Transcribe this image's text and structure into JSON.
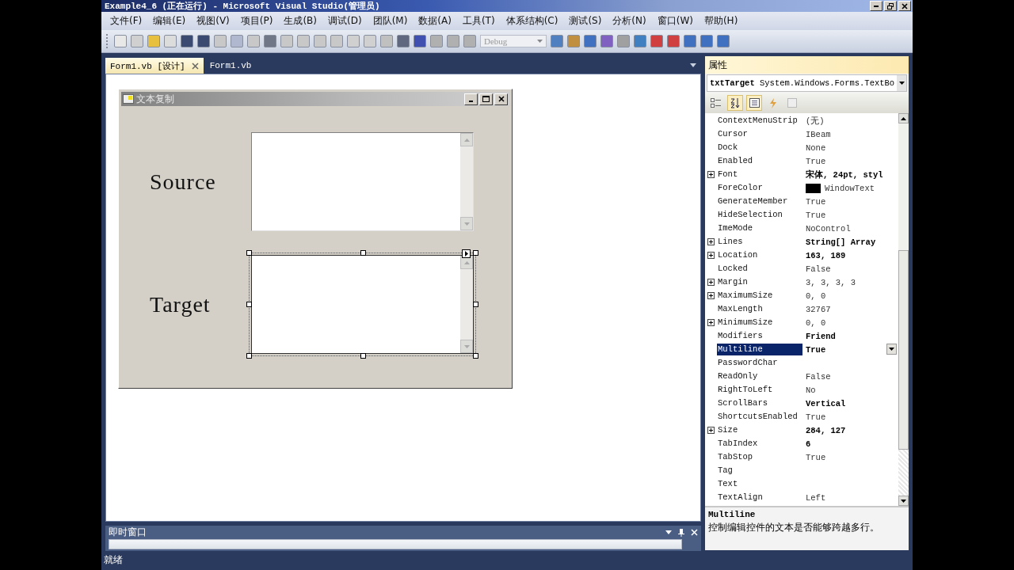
{
  "window": {
    "title": "Example4_6 (正在运行) - Microsoft Visual Studio(管理员)"
  },
  "menu": [
    "文件(F)",
    "编辑(E)",
    "视图(V)",
    "项目(P)",
    "生成(B)",
    "调试(D)",
    "团队(M)",
    "数据(A)",
    "工具(T)",
    "体系结构(C)",
    "测试(S)",
    "分析(N)",
    "窗口(W)",
    "帮助(H)"
  ],
  "toolbar": {
    "configuration": {
      "value": "Debug",
      "disabled": true
    }
  },
  "document_tabs": [
    {
      "label": "Form1.vb [设计]",
      "selected": true
    },
    {
      "label": "Form1.vb",
      "selected": false
    }
  ],
  "designer": {
    "form_title": "文本复制",
    "rows": [
      {
        "label": "Source",
        "selected": false
      },
      {
        "label": "Target",
        "selected": true
      }
    ]
  },
  "properties": {
    "title": "属性",
    "object_name": "txtTarget",
    "object_type": "System.Windows.Forms.TextBo",
    "toolbar": [
      {
        "kind": "categorized",
        "selected": false
      },
      {
        "kind": "alphabetical",
        "selected": true
      },
      {
        "kind": "properties",
        "selected": true
      },
      {
        "kind": "events",
        "selected": false
      },
      {
        "kind": "pages",
        "selected": false
      }
    ],
    "rows": [
      {
        "name": "ContextMenuStrip",
        "value": "(无)",
        "kind": "text",
        "expandable": false,
        "bold": false,
        "selected": false
      },
      {
        "name": "Cursor",
        "value": "IBeam",
        "kind": "text",
        "expandable": false,
        "bold": false,
        "selected": false
      },
      {
        "name": "Dock",
        "value": "None",
        "kind": "text",
        "expandable": false,
        "bold": false,
        "selected": false
      },
      {
        "name": "Enabled",
        "value": "True",
        "kind": "text",
        "expandable": false,
        "bold": false,
        "selected": false
      },
      {
        "name": "Font",
        "value": "宋体, 24pt, styl",
        "kind": "text",
        "expandable": true,
        "bold": true,
        "selected": false
      },
      {
        "name": "ForeColor",
        "value": "WindowText",
        "kind": "swatch",
        "color": "#000000",
        "expandable": false,
        "bold": false,
        "selected": false
      },
      {
        "name": "GenerateMember",
        "value": "True",
        "kind": "text",
        "expandable": false,
        "bold": false,
        "selected": false
      },
      {
        "name": "HideSelection",
        "value": "True",
        "kind": "text",
        "expandable": false,
        "bold": false,
        "selected": false
      },
      {
        "name": "ImeMode",
        "value": "NoControl",
        "kind": "text",
        "expandable": false,
        "bold": false,
        "selected": false
      },
      {
        "name": "Lines",
        "value": "String[] Array",
        "kind": "text",
        "expandable": true,
        "bold": true,
        "selected": false
      },
      {
        "name": "Location",
        "value": "163, 189",
        "kind": "text",
        "expandable": true,
        "bold": true,
        "selected": false
      },
      {
        "name": "Locked",
        "value": "False",
        "kind": "text",
        "expandable": false,
        "bold": false,
        "selected": false
      },
      {
        "name": "Margin",
        "value": "3, 3, 3, 3",
        "kind": "text",
        "expandable": true,
        "bold": false,
        "selected": false
      },
      {
        "name": "MaximumSize",
        "value": "0, 0",
        "kind": "text",
        "expandable": true,
        "bold": false,
        "selected": false
      },
      {
        "name": "MaxLength",
        "value": "32767",
        "kind": "text",
        "expandable": false,
        "bold": false,
        "selected": false
      },
      {
        "name": "MinimumSize",
        "value": "0, 0",
        "kind": "text",
        "expandable": true,
        "bold": false,
        "selected": false
      },
      {
        "name": "Modifiers",
        "value": "Friend",
        "kind": "text",
        "expandable": false,
        "bold": true,
        "selected": false
      },
      {
        "name": "Multiline",
        "value": "True",
        "kind": "text",
        "expandable": false,
        "bold": true,
        "selected": true
      },
      {
        "name": "PasswordChar",
        "kind": "text",
        "expandable": false,
        "selected": false
      },
      {
        "name": "ReadOnly",
        "value": "False",
        "kind": "text",
        "expandable": false,
        "bold": false,
        "selected": false
      },
      {
        "name": "RightToLeft",
        "value": "No",
        "kind": "text",
        "expandable": false,
        "bold": false,
        "selected": false
      },
      {
        "name": "ScrollBars",
        "value": "Vertical",
        "kind": "text",
        "expandable": false,
        "bold": true,
        "selected": false
      },
      {
        "name": "ShortcutsEnabled",
        "value": "True",
        "kind": "text",
        "expandable": false,
        "bold": false,
        "selected": false
      },
      {
        "name": "Size",
        "value": "284, 127",
        "kind": "text",
        "expandable": true,
        "bold": true,
        "selected": false
      },
      {
        "name": "TabIndex",
        "value": "6",
        "kind": "text",
        "expandable": false,
        "bold": true,
        "selected": false
      },
      {
        "name": "TabStop",
        "value": "True",
        "kind": "text",
        "expandable": false,
        "bold": false,
        "selected": false
      },
      {
        "name": "Tag",
        "kind": "text",
        "expandable": false,
        "selected": false
      },
      {
        "name": "Text",
        "kind": "text",
        "expandable": false,
        "selected": false
      },
      {
        "name": "TextAlign",
        "value": "Left",
        "kind": "text",
        "expandable": false,
        "bold": false,
        "selected": false
      }
    ],
    "description": {
      "name": "Multiline",
      "text": "控制编辑控件的文本是否能够跨越多行。"
    }
  },
  "immediate_window": {
    "title": "即时窗口"
  },
  "status_bar": "就绪"
}
